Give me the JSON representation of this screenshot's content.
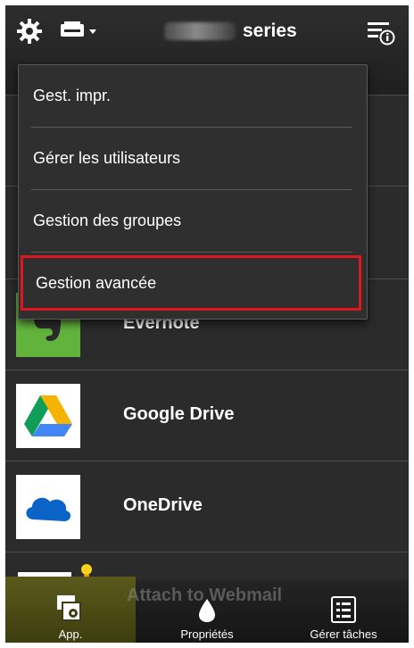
{
  "header": {
    "title_suffix": "series",
    "icons": {
      "settings": "gear-icon",
      "printer": "printer-icon",
      "info_menu": "info-menu-icon"
    }
  },
  "menu": {
    "items": [
      {
        "label": "Gest. impr."
      },
      {
        "label": "Gérer les utilisateurs"
      },
      {
        "label": "Gestion des groupes"
      },
      {
        "label": "Gestion avancée",
        "highlighted": true
      }
    ],
    "highlight_color": "#e0161e"
  },
  "apps": [
    {
      "label": "Evernote",
      "icon": "evernote-icon"
    },
    {
      "label": "Google Drive",
      "icon": "google-drive-icon"
    },
    {
      "label": "OneDrive",
      "icon": "onedrive-icon"
    },
    {
      "label": "Attach to Webmail",
      "icon": "webmail-icon"
    }
  ],
  "bottom_bar": {
    "tabs": [
      {
        "label": "App.",
        "icon": "app-settings-icon",
        "active": true
      },
      {
        "label": "Propriétés",
        "icon": "ink-drop-icon"
      },
      {
        "label": "Gérer tâches",
        "icon": "task-list-icon"
      }
    ]
  }
}
